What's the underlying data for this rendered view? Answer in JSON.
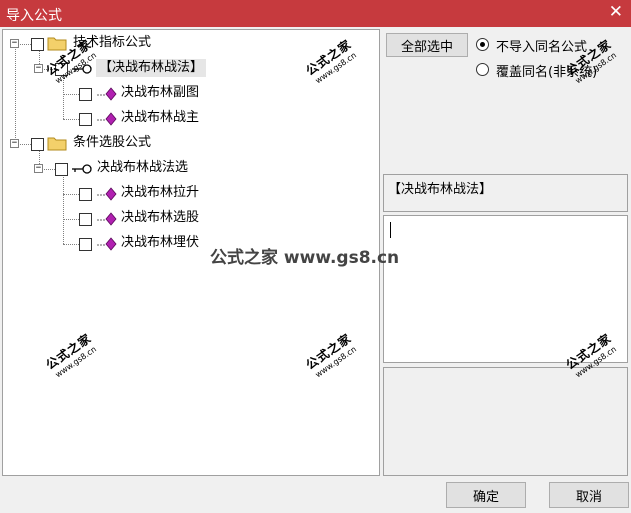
{
  "window": {
    "title": "导入公式"
  },
  "tree": {
    "nodes": [
      {
        "label": "技术指标公式",
        "checked": false
      },
      {
        "label": "【决战布林战法】",
        "checked": false,
        "selected": true
      },
      {
        "label": "决战布林副图",
        "checked": false
      },
      {
        "label": "决战布林战主",
        "checked": false
      },
      {
        "label": "条件选股公式",
        "checked": false
      },
      {
        "label": "决战布林战法选",
        "checked": false
      },
      {
        "label": "决战布林拉升",
        "checked": false
      },
      {
        "label": "决战布林选股",
        "checked": false
      },
      {
        "label": "决战布林埋伏",
        "checked": false
      }
    ]
  },
  "right": {
    "select_all": "全部选中",
    "options": [
      {
        "label": "不导入同名公式",
        "checked": true
      },
      {
        "label": "覆盖同名(非系统)",
        "checked": false
      }
    ],
    "formula_name": "【决战布林战法】"
  },
  "buttons": {
    "ok": "确定",
    "cancel": "取消"
  },
  "watermark": {
    "cn": "公式之家",
    "url": "www.gs8.cn",
    "center": "公式之家 www.gs8.cn"
  },
  "colors": {
    "titlebar": "#c63a3e",
    "folder": "#f3d06a",
    "diamond": "#b020b0"
  }
}
